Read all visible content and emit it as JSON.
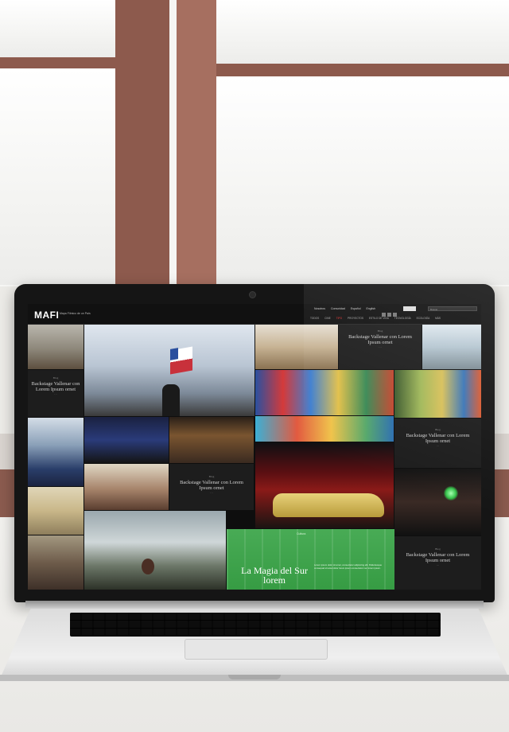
{
  "site": {
    "logo": "MAFI",
    "logo_sub": "Mapa Fílmico de un País",
    "top_links": [
      "Nosotros",
      "Comunidad"
    ],
    "langs": [
      "Español",
      "English"
    ],
    "search_placeholder": "Buscar",
    "nav": [
      "TODOS",
      "CINE",
      "TIPO",
      "PROYECTOS",
      "ESTILO DE VIDA",
      "TECNOLOGÍA",
      "ECOLOGÍA",
      "MÁS"
    ],
    "nav_active": 2
  },
  "cards": [
    {
      "category": "Blog",
      "title": "Backstage Vallenar con Lorem Ipsum ornet",
      "dots": "···"
    },
    {
      "category": "Blog",
      "title": "Backstage Vallenar con Lorem Ipsum ornet",
      "dots": "···"
    },
    {
      "category": "Blog",
      "title": "Backstage Vallenar con Lorem Ipsum ornet",
      "dots": "···"
    },
    {
      "category": "Blog",
      "title": "Backstage Vallenar con Lorem Ipsum ornet",
      "dots": "···"
    },
    {
      "category": "Blog",
      "title": "Backstage Vallenar con Lorem Ipsum ornet",
      "dots": "···"
    }
  ],
  "featured": {
    "category": "Cultura",
    "title": "La Magia del Sur lorem",
    "body": "Lorem ipsum dolor sit amet, consectetur adipiscing elit. Pellentesque consequat sit amet dolor lorem ipsum consectetur nec lorem ipsum."
  },
  "colors": {
    "accent_green": "#39a447",
    "nav_active": "#e33333",
    "frame": "#8d5a4d"
  }
}
